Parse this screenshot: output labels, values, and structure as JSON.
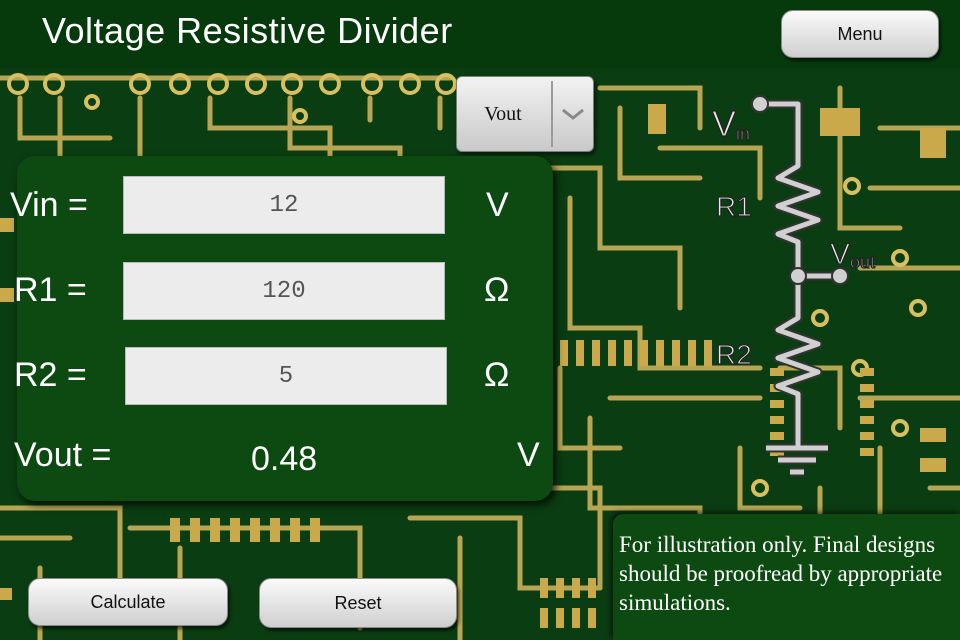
{
  "app": {
    "title": "Voltage Resistive Divider"
  },
  "toolbar": {
    "menu_label": "Menu"
  },
  "mode_select": {
    "selected": "Vout",
    "icon": "chevron-down-icon"
  },
  "form": {
    "vin": {
      "label": "Vin =",
      "value": "12",
      "unit": "V"
    },
    "r1": {
      "label": "R1 =",
      "value": "120",
      "unit": "Ω"
    },
    "r2": {
      "label": "R2 =",
      "value": "5",
      "unit": "Ω"
    },
    "vout": {
      "label": "Vout =",
      "value": "0.48",
      "unit": "V"
    }
  },
  "actions": {
    "calculate_label": "Calculate",
    "reset_label": "Reset"
  },
  "schematic": {
    "vin_main": "V",
    "vin_sub": "in",
    "r1": "R1",
    "vout_main": "V",
    "vout_sub": "out",
    "r2": "R2"
  },
  "disclaimer": "For illustration only. Final designs should be proofread by appropriate simulations.",
  "colors": {
    "background": "#0b3d12",
    "panel": "#0d4a12",
    "trace": "#c8b35a",
    "pad": "#c8a84a"
  }
}
